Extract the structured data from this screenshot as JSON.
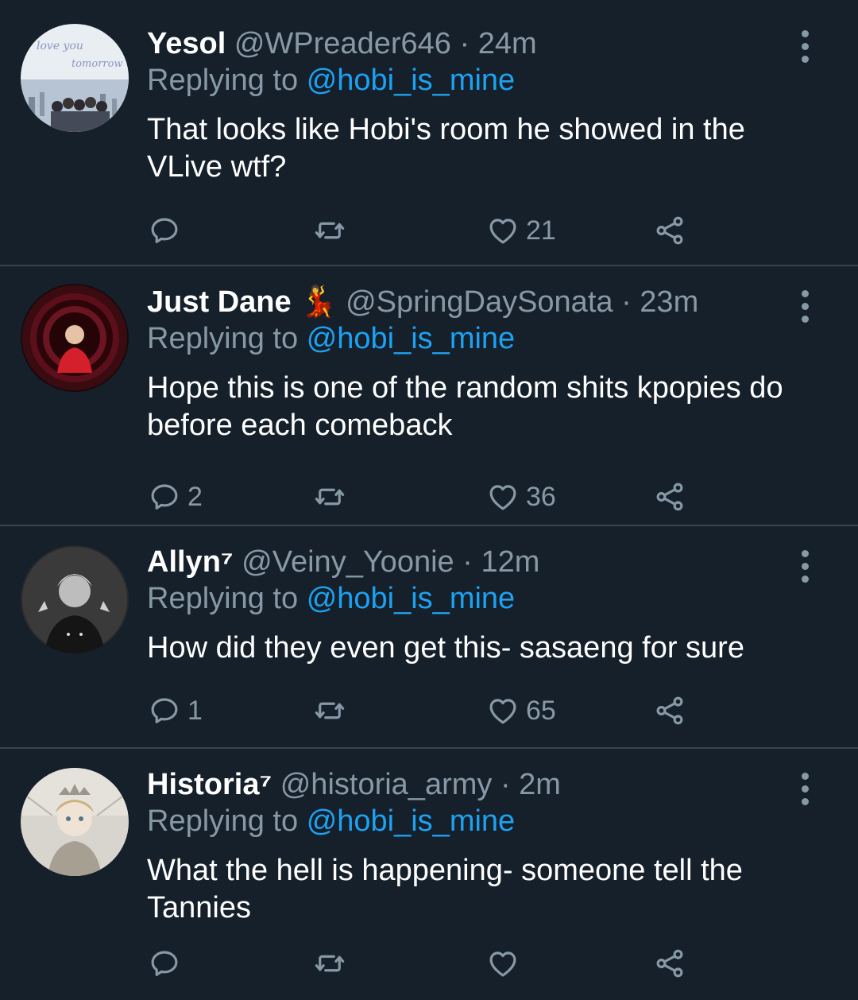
{
  "tweets": [
    {
      "name": "Yesol",
      "badge": "",
      "handle": "@WPreader646",
      "time": "24m",
      "reply_prefix": "Replying to",
      "reply_to": "@hobi_is_mine",
      "text": "That looks like Hobi's room he showed in the VLive wtf?",
      "replies": "",
      "likes": "21",
      "avatar_text": [
        "love you",
        "tomorrow"
      ]
    },
    {
      "name": "Just Dane",
      "badge": "💃",
      "handle": "@SpringDaySonata",
      "time": "23m",
      "reply_prefix": "Replying to",
      "reply_to": "@hobi_is_mine",
      "text": "Hope this is one of the random shits kpopies do before each comeback",
      "replies": "2",
      "likes": "36"
    },
    {
      "name": "Allyn⁷",
      "badge": "",
      "handle": "@Veiny_Yoonie",
      "time": "12m",
      "reply_prefix": "Replying to",
      "reply_to": "@hobi_is_mine",
      "text": "How did they even get this- sasaeng for sure",
      "replies": "1",
      "likes": "65"
    },
    {
      "name": "Historia⁷",
      "badge": "",
      "handle": "@historia_army",
      "time": "2m",
      "reply_prefix": "Replying to",
      "reply_to": "@hobi_is_mine",
      "text": "What the hell is happening- someone tell the Tannies",
      "replies": "",
      "likes": ""
    }
  ],
  "separator": "·",
  "icons": {
    "reply": "reply-icon",
    "retweet": "retweet-icon",
    "like": "heart-icon",
    "share": "share-icon",
    "more": "more-vertical-icon"
  },
  "colors": {
    "background": "#15202b",
    "secondary_text": "#8899a6",
    "link": "#1da1f2",
    "divider": "#38444d"
  }
}
